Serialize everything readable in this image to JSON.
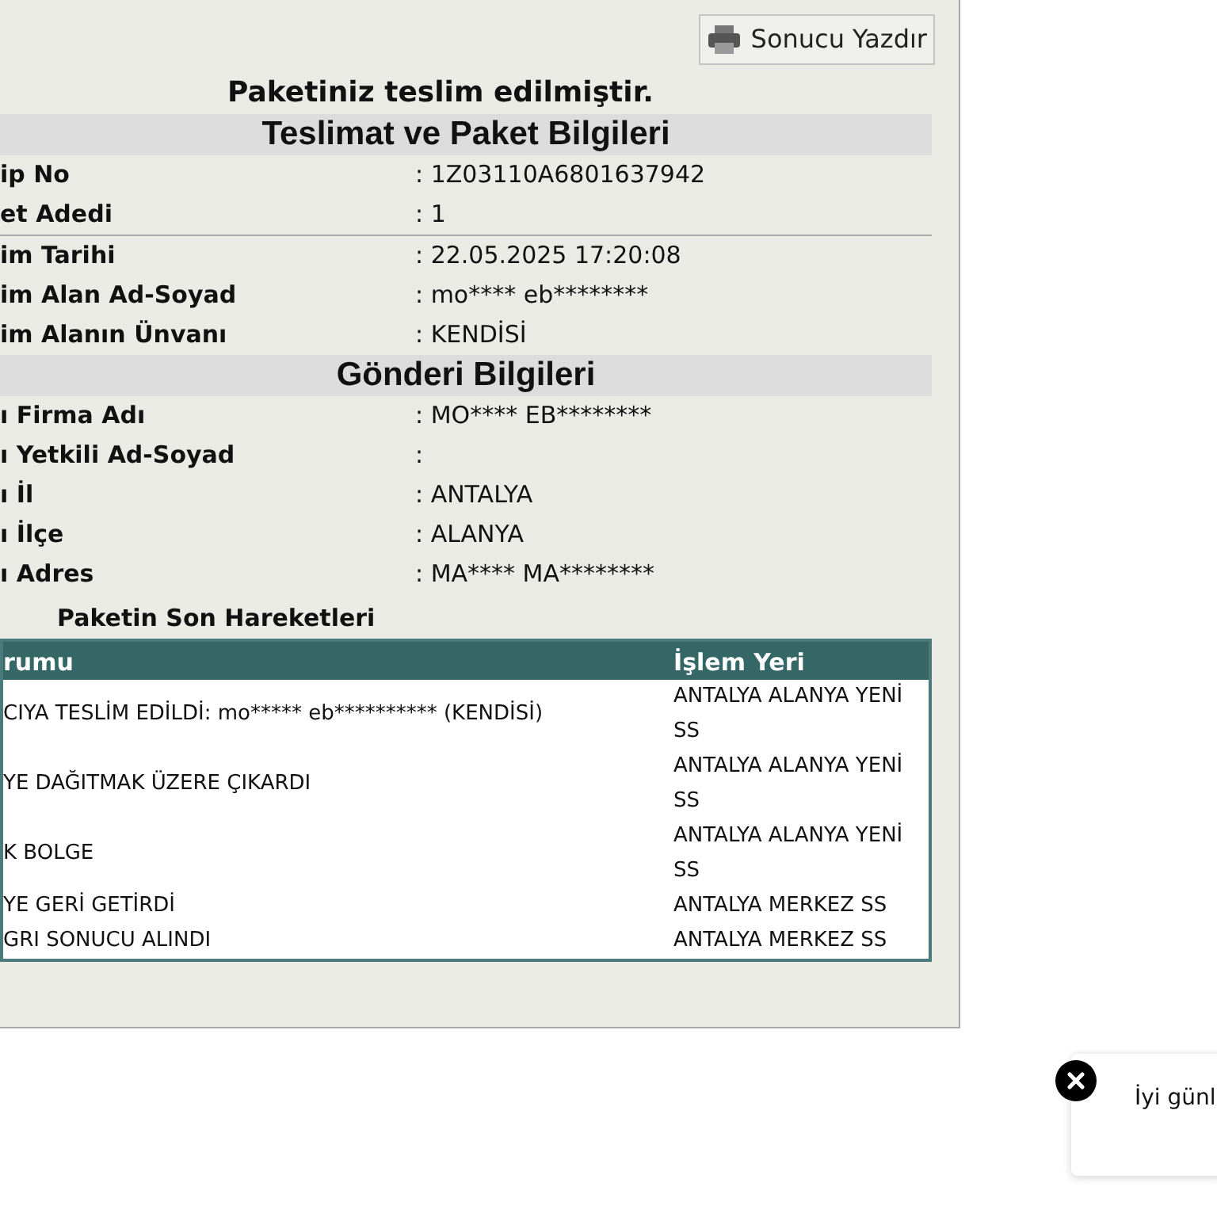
{
  "print_button": {
    "label": "Sonucu Yazdır"
  },
  "status_message": "Paketiniz teslim edilmiştir.",
  "sections": [
    {
      "title": "Teslimat ve Paket Bilgileri",
      "rows": [
        {
          "kind": "field",
          "label": "ip No",
          "value": ": 1Z03110A6801637942"
        },
        {
          "kind": "field",
          "label": "et Adedi",
          "value": ": 1"
        },
        {
          "kind": "divider"
        },
        {
          "kind": "field",
          "label": "im Tarihi",
          "value": ": 22.05.2025 17:20:08"
        },
        {
          "kind": "field",
          "label": "im Alan Ad-Soyad",
          "value": ": mo**** eb********"
        },
        {
          "kind": "field",
          "label": "im Alanın Ünvanı",
          "value": ": KENDİSİ"
        }
      ]
    },
    {
      "title": "Gönderi Bilgileri",
      "rows": [
        {
          "kind": "field",
          "label": "ı Firma Adı",
          "value": ": MO**** EB********"
        },
        {
          "kind": "field",
          "label": "ı Yetkili Ad-Soyad",
          "value": ":"
        },
        {
          "kind": "field",
          "label": "ı İl",
          "value": ": ANTALYA"
        },
        {
          "kind": "field",
          "label": "ı İlçe",
          "value": ": ALANYA"
        },
        {
          "kind": "field",
          "label": "ı Adres",
          "value": ": MA**** MA********"
        }
      ]
    }
  ],
  "movements": {
    "title": "Paketin Son Hareketleri",
    "columns": [
      "rumu",
      "İşlem Yeri"
    ],
    "rows": [
      [
        "CIYA TESLİM EDİLDİ: mo***** eb********** (KENDİSİ)",
        "ANTALYA ALANYA YENİ SS"
      ],
      [
        "YE DAĞITMAK ÜZERE ÇIKARDI",
        "ANTALYA ALANYA YENİ SS"
      ],
      [
        "K BOLGE",
        "ANTALYA ALANYA YENİ SS"
      ],
      [
        "YE GERİ GETİRDİ",
        "ANTALYA MERKEZ SS"
      ],
      [
        "GRI SONUCU ALINDI",
        "ANTALYA MERKEZ SS"
      ]
    ]
  },
  "toast": {
    "text": "İyi günl"
  }
}
